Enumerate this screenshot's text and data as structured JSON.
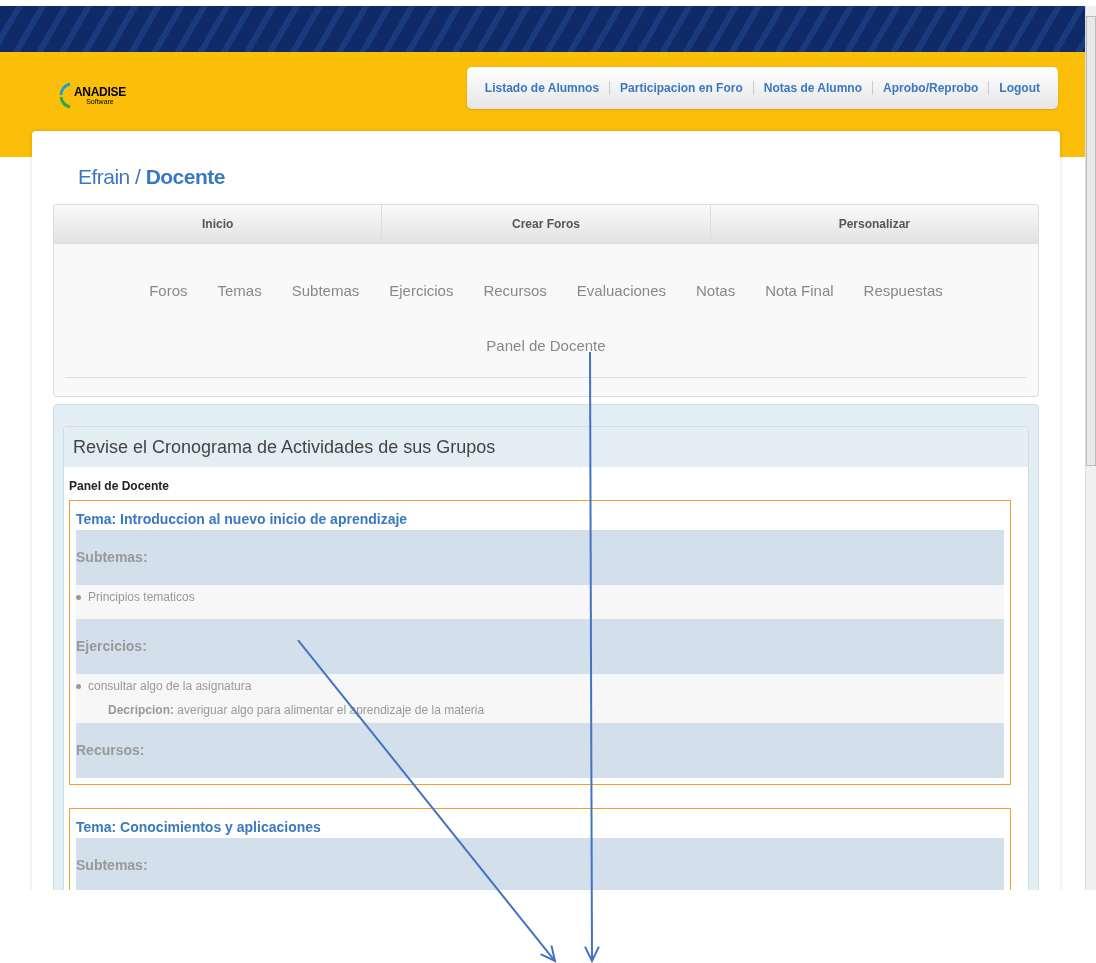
{
  "logo": {
    "title": "ANADISE",
    "subtitle": "Software"
  },
  "top_nav": [
    "Listado de Alumnos",
    "Participacion en Foro",
    "Notas de Alumno",
    "Aprobo/Reprobo",
    "Logout"
  ],
  "breadcrumb": {
    "user": "Efrain",
    "separator": "/",
    "role": "Docente"
  },
  "main_tabs": [
    "Inicio",
    "Crear Foros",
    "Personalizar"
  ],
  "sub_nav": [
    [
      "Foros",
      "Temas",
      "Subtemas",
      "Ejercicios",
      "Recursos",
      "Evaluaciones",
      "Notas",
      "Nota Final",
      "Respuestas"
    ],
    [
      "Panel de Docente"
    ]
  ],
  "panel": {
    "title": "Revise el Cronograma de Actividades de sus Grupos",
    "label": "Panel de Docente",
    "temas": [
      {
        "title": "Tema: Introduccion al nuevo inicio de aprendizaje",
        "sections": [
          {
            "heading": "Subtemas:",
            "items": [
              {
                "text": "Principios tematicos"
              }
            ]
          },
          {
            "heading": "Ejercicios:",
            "items": [
              {
                "text": "consultar algo de la asignatura",
                "description_label": "Decripcion:",
                "description": "averiguar algo para alimentar el aprendizaje de la materia"
              }
            ]
          },
          {
            "heading": "Recursos:"
          }
        ]
      },
      {
        "title": "Tema: Conocimientos y aplicaciones",
        "sections": [
          {
            "heading": "Subtemas:"
          }
        ]
      }
    ]
  }
}
